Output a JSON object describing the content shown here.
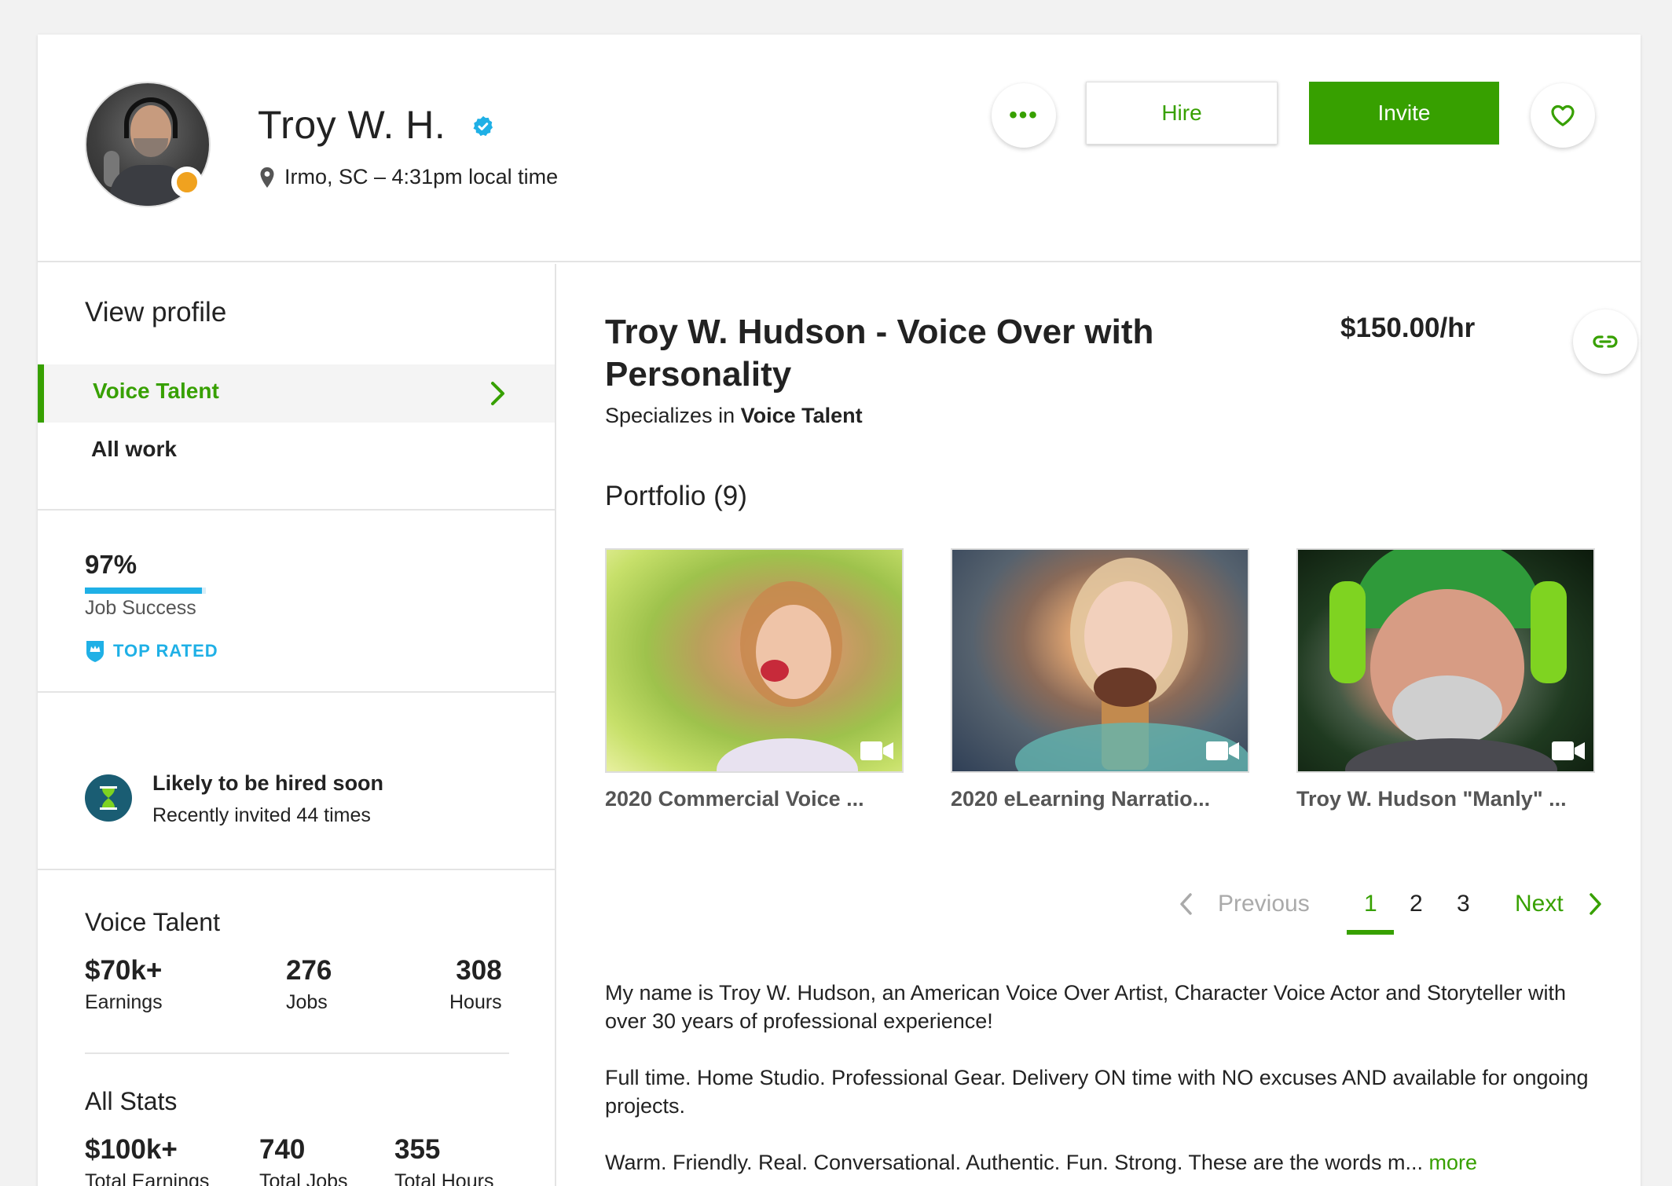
{
  "header": {
    "name": "Troy W. H.",
    "location": "Irmo, SC – 4:31pm local time",
    "hire_label": "Hire",
    "invite_label": "Invite",
    "more_label": "•••",
    "status_color": "#f0a21f",
    "verified_icon": "verified-badge-icon"
  },
  "sidebar": {
    "title": "View profile",
    "items": [
      {
        "label": "Voice Talent",
        "active": true
      },
      {
        "label": "All work",
        "active": false
      }
    ],
    "job_success": {
      "value": "97%",
      "percent": 97,
      "label": "Job Success"
    },
    "badge": "TOP RATED",
    "hired": {
      "title": "Likely to be hired soon",
      "subtitle": "Recently invited 44 times"
    },
    "voice_talent_stats": {
      "title": "Voice Talent",
      "items": [
        {
          "value": "$70k+",
          "label": "Earnings"
        },
        {
          "value": "276",
          "label": "Jobs"
        },
        {
          "value": "308",
          "label": "Hours"
        }
      ]
    },
    "all_stats": {
      "title": "All Stats",
      "items": [
        {
          "value": "$100k+",
          "label": "Total Earnings"
        },
        {
          "value": "740",
          "label": "Total Jobs"
        },
        {
          "value": "355",
          "label": "Total Hours"
        }
      ]
    }
  },
  "main": {
    "title": "Troy W. Hudson - Voice Over with Personality",
    "rate": "$150.00/hr",
    "specializes_prefix": "Specializes in",
    "specializes_value": "Voice Talent",
    "portfolio_title": "Portfolio (9)",
    "portfolio": [
      {
        "caption": "2020 Commercial Voice ..."
      },
      {
        "caption": "2020 eLearning Narratio..."
      },
      {
        "caption": "Troy W. Hudson \"Manly\" ..."
      }
    ],
    "pagination": {
      "previous": "Previous",
      "pages": [
        "1",
        "2",
        "3"
      ],
      "active": "1",
      "next": "Next"
    },
    "description": [
      "My name is Troy W. Hudson, an American Voice Over Artist, Character Voice Actor and Storyteller with over 30 years of professional experience!",
      "Full time. Home Studio. Professional Gear. Delivery ON time with NO excuses AND available for ongoing projects.",
      "Warm. Friendly. Real. Conversational. Authentic. Fun. Strong. These are the words m..."
    ],
    "more_label": "more"
  },
  "colors": {
    "accent": "#37a000",
    "top_rated": "#1fb0e6",
    "hired_icon_bg": "#1a5d73"
  }
}
